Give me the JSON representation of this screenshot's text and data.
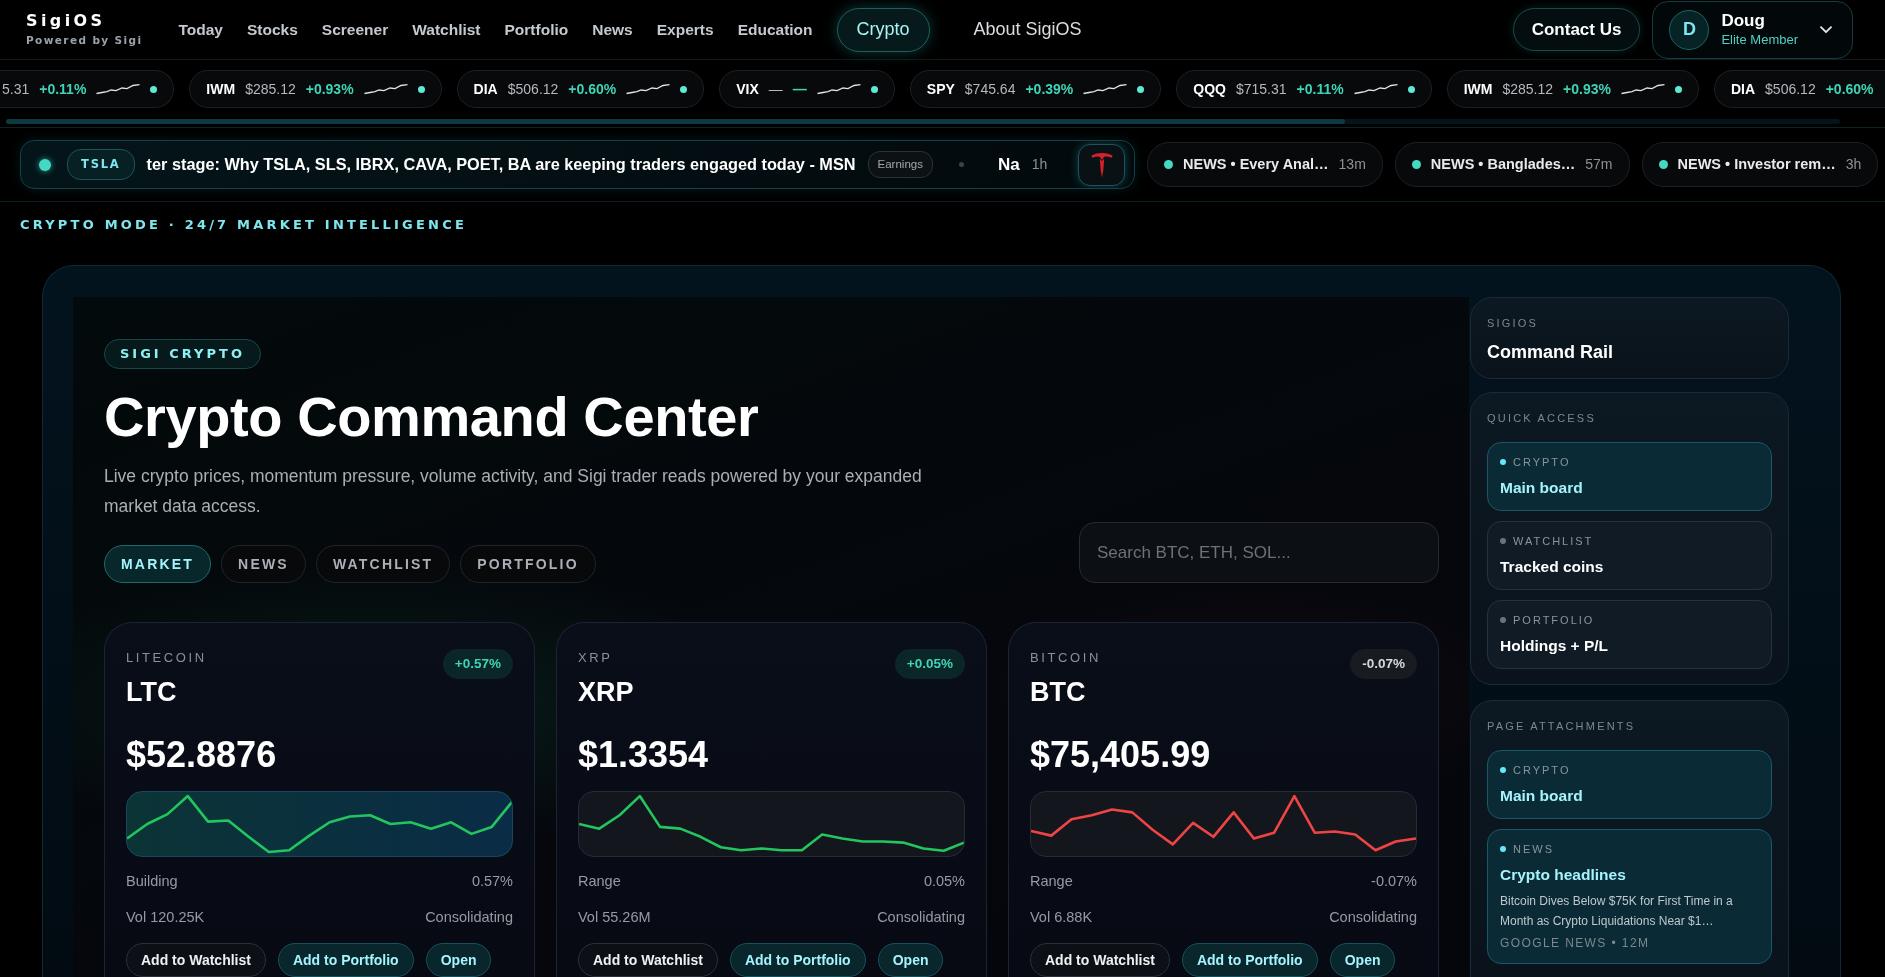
{
  "brand": {
    "name": "SigiOS",
    "tagline": "Powered by Sigi"
  },
  "nav": [
    {
      "label": "Today",
      "selected": false
    },
    {
      "label": "Stocks",
      "selected": false
    },
    {
      "label": "Screener",
      "selected": false
    },
    {
      "label": "Watchlist",
      "selected": false
    },
    {
      "label": "Portfolio",
      "selected": false
    },
    {
      "label": "News",
      "selected": false
    },
    {
      "label": "Experts",
      "selected": false
    },
    {
      "label": "Education",
      "selected": false
    }
  ],
  "mode_links": [
    {
      "label": "Crypto",
      "selected": true
    },
    {
      "label": "About SigiOS",
      "selected": false
    }
  ],
  "contact_button": "Contact Us",
  "user": {
    "initial": "D",
    "name": "Doug",
    "tier": "Elite Member"
  },
  "ticker": [
    {
      "price": "5.31",
      "change": "+0.11%"
    },
    {
      "symbol": "IWM",
      "price": "$285.12",
      "change": "+0.93%"
    },
    {
      "symbol": "DIA",
      "price": "$506.12",
      "change": "+0.60%"
    },
    {
      "symbol": "VIX",
      "price": "—",
      "change": "—"
    },
    {
      "symbol": "SPY",
      "price": "$745.64",
      "change": "+0.39%"
    },
    {
      "symbol": "QQQ",
      "price": "$715.31",
      "change": "+0.11%"
    },
    {
      "symbol": "IWM",
      "price": "$285.12",
      "change": "+0.93%"
    },
    {
      "symbol": "DIA",
      "price": "$506.12",
      "change": "+0.60%"
    }
  ],
  "news_ticker": {
    "symbol": "TSLA",
    "headline": "ter stage: Why TSLA, SLS, IBRX, CAVA, POET, BA are keeping traders engaged today - MSN",
    "tag": "Earnings",
    "next_headline": "Na",
    "age": "1h"
  },
  "news_chips": [
    {
      "title": "NEWS • Every Anal…",
      "age": "13m"
    },
    {
      "title": "NEWS • Banglades…",
      "age": "57m"
    },
    {
      "title": "NEWS • Investor rem…",
      "age": "3h"
    }
  ],
  "mode_banner": "CRYPTO MODE · 24/7 MARKET INTELLIGENCE",
  "hero": {
    "badge": "SIGI CRYPTO",
    "title": "Crypto Command Center",
    "description": "Live crypto prices, momentum pressure, volume activity, and Sigi trader reads powered by your expanded market data access.",
    "tabs": [
      {
        "label": "MARKET",
        "selected": true
      },
      {
        "label": "NEWS",
        "selected": false
      },
      {
        "label": "WATCHLIST",
        "selected": false
      },
      {
        "label": "PORTFOLIO",
        "selected": false
      }
    ],
    "search": {
      "placeholder": "Search BTC, ETH, SOL..."
    }
  },
  "cards": [
    {
      "name": "LITECOIN",
      "symbol": "LTC",
      "change": "+0.57%",
      "kind": "gain",
      "price": "$52.8876",
      "highlighted": true,
      "signal": "Building",
      "signal_change": "0.57%",
      "volume": "Vol 120.25K",
      "status": "Consolidating",
      "actions": [
        {
          "label": "Add to Watchlist",
          "kind": "secondary"
        },
        {
          "label": "Add to Portfolio",
          "kind": "primary"
        },
        {
          "label": "Open",
          "kind": "primary"
        }
      ]
    },
    {
      "name": "XRP",
      "symbol": "XRP",
      "change": "+0.05%",
      "kind": "gain",
      "price": "$1.3354",
      "highlighted": false,
      "signal": "Range",
      "signal_change": "0.05%",
      "volume": "Vol 55.26M",
      "status": "Consolidating",
      "actions": [
        {
          "label": "Add to Watchlist",
          "kind": "secondary"
        },
        {
          "label": "Add to Portfolio",
          "kind": "primary"
        },
        {
          "label": "Open",
          "kind": "primary"
        }
      ]
    },
    {
      "name": "BITCOIN",
      "symbol": "BTC",
      "change": "-0.07%",
      "kind": "loss",
      "price": "$75,405.99",
      "highlighted": false,
      "signal": "Range",
      "signal_change": "-0.07%",
      "volume": "Vol 6.88K",
      "status": "Consolidating",
      "actions": [
        {
          "label": "Add to Watchlist",
          "kind": "secondary"
        },
        {
          "label": "Add to Portfolio",
          "kind": "primary"
        },
        {
          "label": "Open",
          "kind": "primary"
        }
      ]
    }
  ],
  "rail": {
    "header": {
      "eyebrow": "SIGIOS",
      "title": "Command Rail"
    },
    "sections": [
      {
        "heading": "QUICK ACCESS",
        "items": [
          {
            "category": "CRYPTO",
            "title": "Main board",
            "selected": true
          },
          {
            "category": "WATCHLIST",
            "title": "Tracked coins",
            "selected": false
          },
          {
            "category": "PORTFOLIO",
            "title": "Holdings + P/L",
            "selected": false
          }
        ]
      },
      {
        "heading": "PAGE ATTACHMENTS",
        "items": [
          {
            "category": "CRYPTO",
            "title": "Main board",
            "selected": true
          },
          {
            "category": "NEWS",
            "title": "Crypto headlines",
            "summary": "Bitcoin Dives Below $75K for First Time in a Month as Crypto Liquidations Near $1…",
            "meta": "GOOGLE NEWS • 12M",
            "selected": true
          }
        ]
      }
    ]
  }
}
